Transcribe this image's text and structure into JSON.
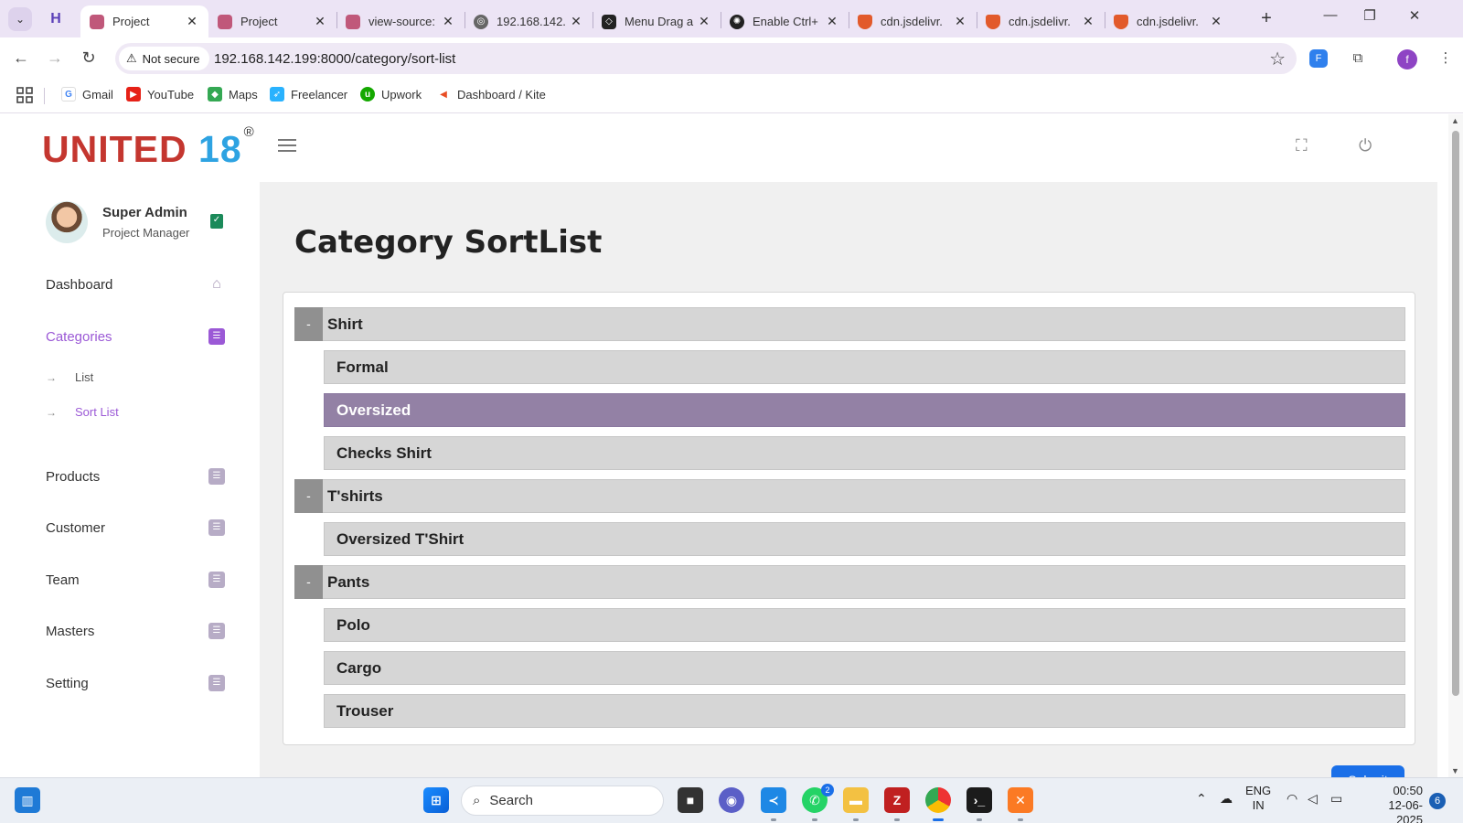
{
  "browser": {
    "tabs": [
      {
        "title": "Project",
        "active": true
      },
      {
        "title": "Project",
        "active": false
      },
      {
        "title": "view-source:",
        "active": false
      },
      {
        "title": "192.168.142.",
        "active": false
      },
      {
        "title": "Menu Drag a",
        "active": false
      },
      {
        "title": "Enable Ctrl+",
        "active": false
      },
      {
        "title": "cdn.jsdelivr.",
        "active": false
      },
      {
        "title": "cdn.jsdelivr.",
        "active": false
      },
      {
        "title": "cdn.jsdelivr.",
        "active": false
      }
    ],
    "security_label": "Not secure",
    "url": "192.168.142.199:8000/category/sort-list",
    "profile_initial": "f",
    "bookmarks": [
      "Gmail",
      "YouTube",
      "Maps",
      "Freelancer",
      "Upwork",
      "Dashboard / Kite"
    ]
  },
  "app": {
    "logo_main": "UNITED",
    "logo_num": "18",
    "logo_mark": "®",
    "user_name": "Super Admin",
    "user_role": "Project Manager",
    "nav": {
      "dashboard": "Dashboard",
      "categories": "Categories",
      "list": "List",
      "sort_list": "Sort List",
      "products": "Products",
      "customer": "Customer",
      "team": "Team",
      "masters": "Masters",
      "setting": "Setting"
    },
    "page_title": "Category SortList",
    "collapse_symbol": "-",
    "categories": [
      {
        "name": "Shirt",
        "children": [
          "Formal",
          "Oversized",
          "Checks Shirt"
        ]
      },
      {
        "name": "T'shirts",
        "children": [
          "Oversized T'Shirt"
        ]
      },
      {
        "name": "Pants",
        "children": [
          "Polo",
          "Cargo",
          "Trouser"
        ]
      }
    ],
    "highlighted_item": "Oversized",
    "submit_label": "Submit",
    "accent_color": "#9b59d6",
    "highlight_color": "#9381a5"
  },
  "taskbar": {
    "search_placeholder": "Search",
    "whatsapp_badge": "2",
    "language": "ENG",
    "region": "IN",
    "time": "00:50",
    "date": "12-06-2025",
    "notifications": "6"
  }
}
